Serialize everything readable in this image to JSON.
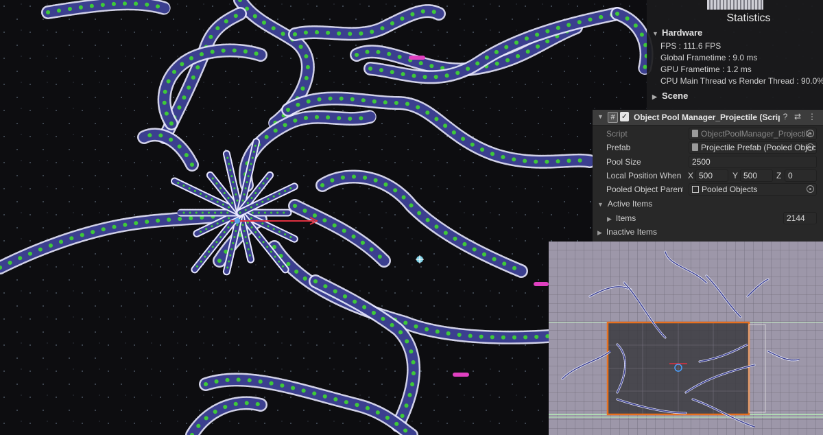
{
  "statistics": {
    "title": "Statistics",
    "hardware": {
      "heading": "Hardware",
      "lines": [
        "FPS : 111.6 FPS",
        "Global Frametime : 9.0 ms",
        "GPU Frametime : 1.2 ms",
        "CPU Main Thread vs Render Thread : 90.0%"
      ]
    },
    "scene_heading": "Scene"
  },
  "inspector": {
    "component_title": "Object Pool Manager_Projectile (Script)",
    "script_label": "Script",
    "script_value": "ObjectPoolManager_Projectile",
    "prefab_label": "Prefab",
    "prefab_value": "Projectile Prefab (Pooled Object)",
    "pool_size_label": "Pool Size",
    "pool_size_value": "2500",
    "local_position_label": "Local Position When Inactive",
    "pos": {
      "x_label": "X",
      "x": "500",
      "y_label": "Y",
      "y": "500",
      "z_label": "Z",
      "z": "0"
    },
    "pooled_parent_label": "Pooled Object Parent",
    "pooled_parent_value": "Pooled Objects",
    "active_items_label": "Active Items",
    "items_label": "Items",
    "items_count": "2144",
    "inactive_items_label": "Inactive Items"
  },
  "colors": {
    "background": "#0d0d10",
    "projectile_body": "#3b3f8f",
    "projectile_outline": "#e8e8ff",
    "projectile_eye": "#3ec93a",
    "camera_frame": "#e8701e",
    "minimap_bg": "#9c96a8",
    "powerup": "#e040c0"
  }
}
